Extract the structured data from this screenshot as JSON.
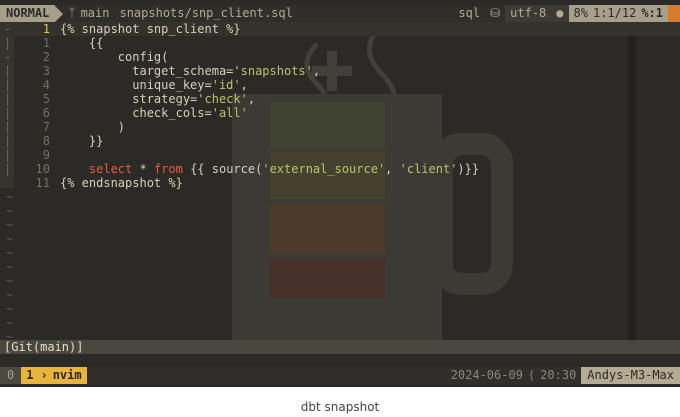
{
  "statusline": {
    "mode": "NORMAL",
    "branch_icon": "git-branch-icon",
    "branch": "main",
    "file": "snapshots/snp_client.sql",
    "filetype": "sql",
    "db_icon": "database-icon",
    "encoding": "utf-8",
    "os_icon": "apple-icon",
    "percent": "8%",
    "position": "1:1/12",
    "column": "%:1"
  },
  "buffer": {
    "lines": [
      {
        "num": "1",
        "text": "{% snapshot snp_client %}"
      },
      {
        "num": "1",
        "text": "    {{"
      },
      {
        "num": "2",
        "text": "        config("
      },
      {
        "num": "3",
        "text": "          target_schema='snapshots',"
      },
      {
        "num": "4",
        "text": "          unique_key='id',"
      },
      {
        "num": "5",
        "text": "          strategy='check',"
      },
      {
        "num": "6",
        "text": "          check_cols='all'"
      },
      {
        "num": "7",
        "text": "        )"
      },
      {
        "num": "8",
        "text": "    }}"
      },
      {
        "num": "9",
        "text": ""
      },
      {
        "num": "10",
        "text": "    select * from {{ source('external_source', 'client')}}"
      },
      {
        "num": "11",
        "text": "{% endsnapshot %}"
      }
    ],
    "tilde": "~"
  },
  "gitline": "[Git(main)]",
  "tmux": {
    "index": "0",
    "window_num": "1",
    "window_name": "nvim",
    "date": "2024-06-09",
    "time": "20:30",
    "host": "Andys-M3-Max"
  },
  "caption": "dbt snapshot",
  "colors": {
    "background": "#2b2a27",
    "keyword": "#e35f3b",
    "string": "#b7c66a",
    "accent": "#e8b43a"
  }
}
